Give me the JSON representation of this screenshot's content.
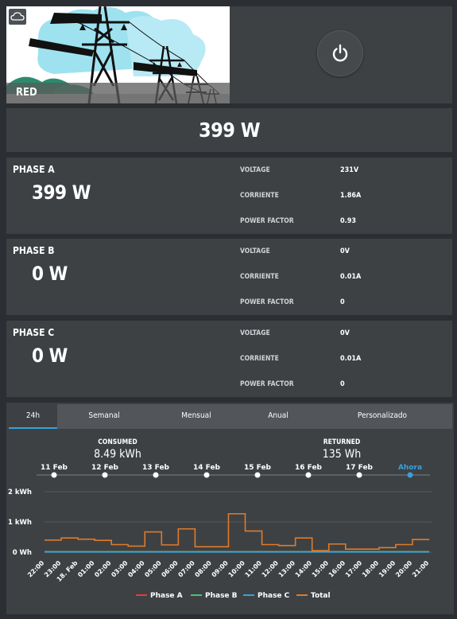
{
  "top": {
    "image_caption": "RED",
    "cloud_icon": "cloud-icon",
    "power_icon": "power-icon"
  },
  "total": {
    "value": "399 W"
  },
  "phases": [
    {
      "title": "PHASE A",
      "value": "399 W",
      "metrics": [
        {
          "label": "VOLTAGE",
          "value": "231V"
        },
        {
          "label": "CORRIENTE",
          "value": "1.86A"
        },
        {
          "label": "POWER FACTOR",
          "value": "0.93"
        }
      ]
    },
    {
      "title": "PHASE B",
      "value": "0 W",
      "metrics": [
        {
          "label": "VOLTAGE",
          "value": "0V"
        },
        {
          "label": "CORRIENTE",
          "value": "0.01A"
        },
        {
          "label": "POWER FACTOR",
          "value": "0"
        }
      ]
    },
    {
      "title": "PHASE C",
      "value": "0 W",
      "metrics": [
        {
          "label": "VOLTAGE",
          "value": "0V"
        },
        {
          "label": "CORRIENTE",
          "value": "0.01A"
        },
        {
          "label": "POWER FACTOR",
          "value": "0"
        }
      ]
    }
  ],
  "tabs": [
    {
      "label": "24h",
      "active": true
    },
    {
      "label": "Semanal",
      "active": false
    },
    {
      "label": "Mensual",
      "active": false
    },
    {
      "label": "Anual",
      "active": false
    },
    {
      "label": "Personalizado",
      "active": false
    }
  ],
  "stats": {
    "consumed_label": "CONSUMED",
    "consumed_value": "8.49 kWh",
    "returned_label": "RETURNED",
    "returned_value": "135 Wh"
  },
  "timeline": {
    "labels": [
      "11 Feb",
      "12 Feb",
      "13 Feb",
      "14 Feb",
      "15 Feb",
      "16 Feb",
      "17 Feb",
      "Ahora"
    ],
    "current_color": "#3aa0d8"
  },
  "colors": {
    "phase_a": "#e0403a",
    "phase_b": "#4cc07a",
    "phase_c": "#3aa0d8",
    "total": "#e07a2a",
    "accent": "#3aa0d8"
  },
  "chart_data": {
    "type": "line",
    "y_ticks": [
      "2 kWh",
      "1 kWh",
      "0 Wh"
    ],
    "ylim": [
      0,
      2
    ],
    "x_ticks": [
      "22:00",
      "23:00",
      "18. Feb",
      "01:00",
      "02:00",
      "03:00",
      "04:00",
      "05:00",
      "06:00",
      "07:00",
      "08:00",
      "09:00",
      "10:00",
      "11:00",
      "12:00",
      "13:00",
      "14:00",
      "15:00",
      "16:00",
      "17:00",
      "18:00",
      "19:00",
      "20:00",
      "21:00"
    ],
    "series": [
      {
        "name": "Phase A",
        "color": "#e0403a",
        "values": [
          0.02,
          0.02,
          0.02,
          0.02,
          0.02,
          0.02,
          0.02,
          0.02,
          0.02,
          0.02,
          0.02,
          0.02,
          0.02,
          0.02,
          0.02,
          0.02,
          0.02,
          0.02,
          0.02,
          0.02,
          0.02,
          0.02,
          0.02
        ]
      },
      {
        "name": "Phase B",
        "color": "#4cc07a",
        "values": [
          0.02,
          0.02,
          0.02,
          0.02,
          0.02,
          0.02,
          0.02,
          0.02,
          0.02,
          0.02,
          0.02,
          0.02,
          0.02,
          0.02,
          0.02,
          0.02,
          0.02,
          0.02,
          0.02,
          0.02,
          0.02,
          0.02,
          0.02
        ]
      },
      {
        "name": "Phase C",
        "color": "#3aa0d8",
        "values": [
          0,
          0,
          0,
          0,
          0,
          0,
          0,
          0,
          0,
          0,
          0,
          0,
          0,
          0,
          0,
          0,
          0,
          0,
          0,
          0,
          0,
          0,
          0
        ]
      },
      {
        "name": "Total",
        "color": "#e07a2a",
        "values": [
          0.4,
          0.47,
          0.43,
          0.39,
          0.25,
          0.2,
          0.67,
          0.24,
          0.77,
          0.18,
          0.18,
          1.27,
          0.7,
          0.25,
          0.22,
          0.47,
          0.05,
          0.27,
          0.1,
          0.1,
          0.15,
          0.25,
          0.42
        ]
      }
    ],
    "legend": [
      "Phase A",
      "Phase B",
      "Phase C",
      "Total"
    ],
    "legend_position": "bottom"
  }
}
